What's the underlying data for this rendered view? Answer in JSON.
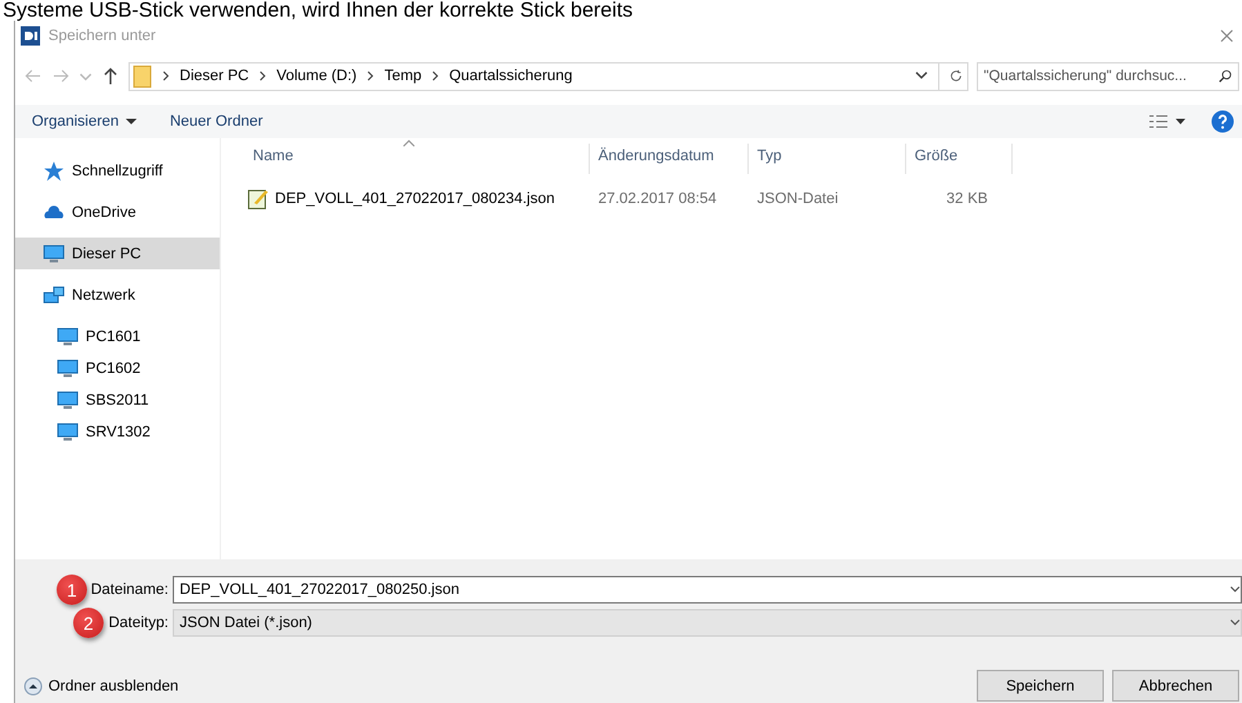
{
  "background_text": "Systeme USB-Stick verwenden, wird Ihnen der korrekte Stick bereits",
  "window": {
    "title": "Speichern unter"
  },
  "breadcrumb": [
    "Dieser PC",
    "Volume (D:)",
    "Temp",
    "Quartalssicherung"
  ],
  "search": {
    "placeholder": "\"Quartalssicherung\" durchsuc..."
  },
  "toolbar": [
    "Organisieren",
    "Neuer Ordner"
  ],
  "sidebar": {
    "items": [
      {
        "label": "Schnellzugriff",
        "kind": "star",
        "selected": false
      },
      {
        "label": "OneDrive",
        "kind": "cloud",
        "selected": false
      },
      {
        "label": "Dieser PC",
        "kind": "pc",
        "selected": true
      },
      {
        "label": "Netzwerk",
        "kind": "network",
        "selected": false,
        "children": [
          {
            "label": "PC1601",
            "kind": "pc",
            "selected": false
          },
          {
            "label": "PC1602",
            "kind": "pc",
            "selected": false
          },
          {
            "label": "SBS2011",
            "kind": "pc",
            "selected": false
          },
          {
            "label": "SRV1302",
            "kind": "pc",
            "selected": false
          }
        ]
      }
    ]
  },
  "table": {
    "columns": [
      "Name",
      "Änderungsdatum",
      "Typ",
      "Größe"
    ],
    "rows": [
      {
        "name": "DEP_VOLL_401_27022017_080234.json",
        "date": "27.02.2017 08:54",
        "type": "JSON-Datei",
        "size": "32 KB"
      }
    ]
  },
  "filename": {
    "label": "Dateiname:",
    "value": "DEP_VOLL_401_27022017_080250.json",
    "badge": "1"
  },
  "filetype": {
    "label": "Dateityp:",
    "value": "JSON Datei (*.json)",
    "badge": "2"
  },
  "hide_folders": "Ordner ausblenden",
  "buttons": [
    "Speichern",
    "Abbrechen"
  ]
}
